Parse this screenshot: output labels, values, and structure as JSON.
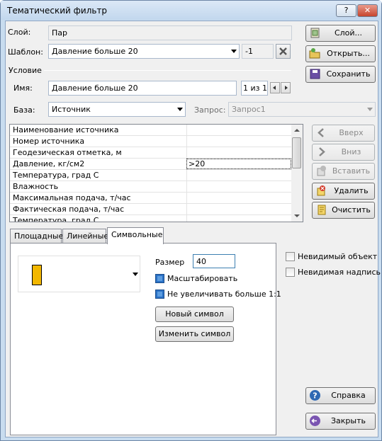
{
  "window": {
    "title": "Тематический фильтр",
    "help_label": "?",
    "close_label": "✕"
  },
  "layer": {
    "label": "Слой:",
    "value": "Пар",
    "button": "Слой..."
  },
  "template": {
    "label": "Шаблон:",
    "value": "Давление больше 20",
    "index": "-1",
    "open_button": "Открыть...",
    "save_button": "Сохранить"
  },
  "condition": {
    "group_label": "Условие",
    "name_label": "Имя:",
    "name_value": "Давление больше 20",
    "counter": "1 из 1",
    "base_label": "База:",
    "base_value": "Источник",
    "query_label": "Запрос:",
    "query_value": "Запрос1"
  },
  "grid": {
    "rows": [
      {
        "name": "Наименование источника",
        "value": ""
      },
      {
        "name": "Номер источника",
        "value": ""
      },
      {
        "name": "Геодезическая отметка, м",
        "value": ""
      },
      {
        "name": "Давление, кг/см2",
        "value": ">20"
      },
      {
        "name": "Температура, град С",
        "value": ""
      },
      {
        "name": "Влажность",
        "value": ""
      },
      {
        "name": "Максимальная подача, т/час",
        "value": ""
      },
      {
        "name": "Фактическая подача, т/час",
        "value": ""
      },
      {
        "name": "Температура, град С",
        "value": ""
      }
    ]
  },
  "side_buttons": {
    "up": "Вверх",
    "down": "Вниз",
    "insert": "Вставить",
    "delete": "Удалить",
    "clear": "Очистить"
  },
  "tabs": [
    "Площадные",
    "Линейные",
    "Символьные"
  ],
  "symbol": {
    "size_label": "Размер",
    "size_value": "40",
    "scale_label": "Масштабировать",
    "no_enlarge_label": "Не увеличивать больше 1:1",
    "new_symbol_button": "Новый символ",
    "edit_symbol_button": "Изменить символ",
    "swatch_color": "#f2b700"
  },
  "options": {
    "invisible_object": "Невидимый объект",
    "invisible_label": "Невидимая надпись"
  },
  "footer": {
    "help_button": "Справка",
    "close_button": "Закрыть"
  }
}
